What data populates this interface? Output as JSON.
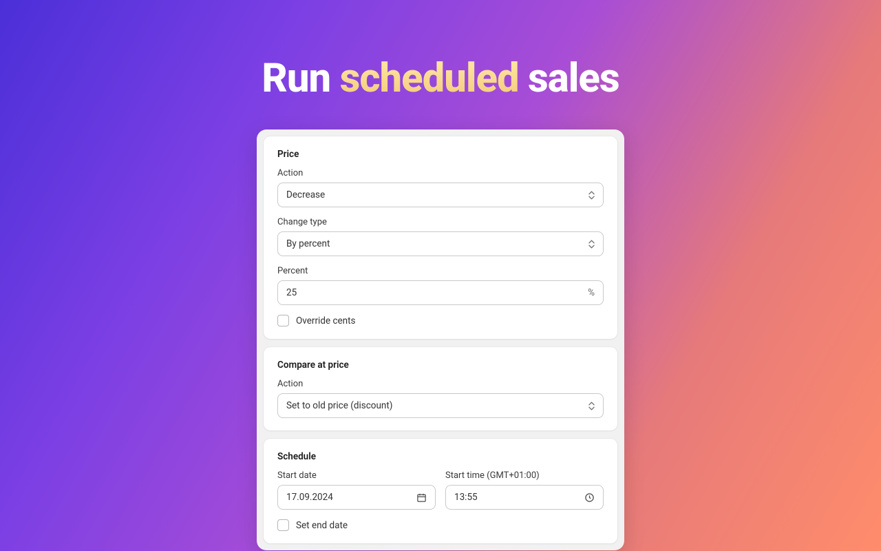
{
  "heading": {
    "part1": "Run ",
    "highlight": "scheduled",
    "part2": " sales"
  },
  "price": {
    "title": "Price",
    "action_label": "Action",
    "action_value": "Decrease",
    "change_type_label": "Change type",
    "change_type_value": "By percent",
    "percent_label": "Percent",
    "percent_value": "25",
    "percent_suffix": "%",
    "override_cents_label": "Override cents"
  },
  "compare": {
    "title": "Compare at price",
    "action_label": "Action",
    "action_value": "Set to old price (discount)"
  },
  "schedule": {
    "title": "Schedule",
    "start_date_label": "Start date",
    "start_date_value": "17.09.2024",
    "start_time_label": "Start time (GMT+01:00)",
    "start_time_value": "13:55",
    "set_end_date_label": "Set end date"
  }
}
